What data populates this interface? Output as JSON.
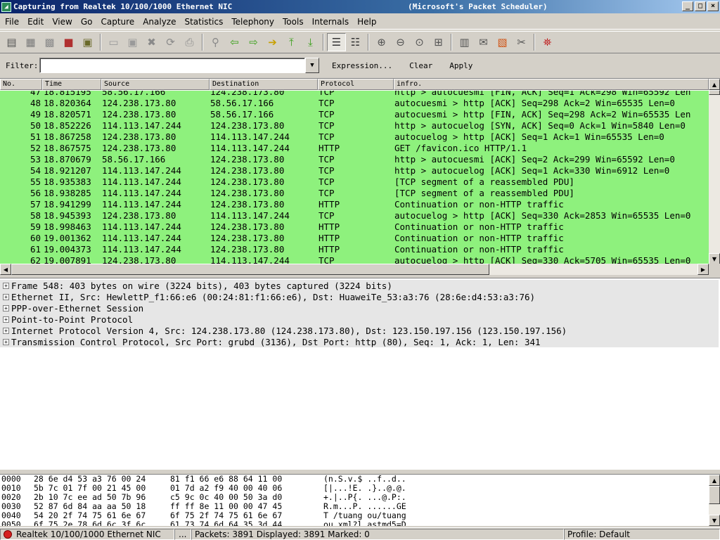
{
  "window": {
    "title": "Capturing from Realtek 10/100/1000 Ethernet NIC",
    "title_suffix": "(Microsoft's Packet Scheduler)",
    "buttons": {
      "minimize": "_",
      "maximize": "□",
      "close": "×"
    }
  },
  "menu": [
    "File",
    "Edit",
    "View",
    "Go",
    "Capture",
    "Analyze",
    "Statistics",
    "Telephony",
    "Tools",
    "Internals",
    "Help"
  ],
  "toolbar": {
    "icons": [
      {
        "name": "interfaces-icon",
        "glyph": "▤",
        "color": "#555555"
      },
      {
        "name": "capture-options-icon",
        "glyph": "▦",
        "color": "#7a7a7a"
      },
      {
        "name": "start-capture-icon",
        "glyph": "▩",
        "color": "#8a8a8a"
      },
      {
        "name": "stop-capture-icon",
        "glyph": "■",
        "color": "#b03030"
      },
      {
        "name": "restart-capture-icon",
        "glyph": "▣",
        "color": "#6a6a2a"
      },
      {
        "name": "sep"
      },
      {
        "name": "open-file-icon",
        "glyph": "▭",
        "color": "#9a9a9a"
      },
      {
        "name": "save-file-icon",
        "glyph": "▣",
        "color": "#9a9a9a"
      },
      {
        "name": "close-file-icon",
        "glyph": "✖",
        "color": "#8a8a8a"
      },
      {
        "name": "reload-icon",
        "glyph": "⟳",
        "color": "#8a8a8a"
      },
      {
        "name": "print-icon",
        "glyph": "⎙",
        "color": "#8a8a8a"
      },
      {
        "name": "sep"
      },
      {
        "name": "find-packet-icon",
        "glyph": "⚲",
        "color": "#8a8a8a"
      },
      {
        "name": "go-back-icon",
        "glyph": "⇦",
        "color": "#3aa01a"
      },
      {
        "name": "go-forward-icon",
        "glyph": "⇨",
        "color": "#3aa01a"
      },
      {
        "name": "go-to-packet-icon",
        "glyph": "➔",
        "color": "#c8a000"
      },
      {
        "name": "go-first-icon",
        "glyph": "⤒",
        "color": "#3aa01a"
      },
      {
        "name": "go-last-icon",
        "glyph": "⤓",
        "color": "#3aa01a"
      },
      {
        "name": "sep"
      },
      {
        "name": "colorize-icon",
        "glyph": "☰",
        "color": "#333333",
        "active": true
      },
      {
        "name": "auto-scroll-icon",
        "glyph": "☷",
        "color": "#333333"
      },
      {
        "name": "sep"
      },
      {
        "name": "zoom-in-icon",
        "glyph": "⊕",
        "color": "#555555"
      },
      {
        "name": "zoom-out-icon",
        "glyph": "⊖",
        "color": "#555555"
      },
      {
        "name": "zoom-normal-icon",
        "glyph": "⊙",
        "color": "#555555"
      },
      {
        "name": "resize-columns-icon",
        "glyph": "⊞",
        "color": "#555555"
      },
      {
        "name": "sep"
      },
      {
        "name": "capture-filters-icon",
        "glyph": "▥",
        "color": "#555555"
      },
      {
        "name": "display-filters-icon",
        "glyph": "✉",
        "color": "#555555"
      },
      {
        "name": "coloring-rules-icon",
        "glyph": "▧",
        "color": "#d05010"
      },
      {
        "name": "preferences-icon",
        "glyph": "✂",
        "color": "#555555"
      },
      {
        "name": "sep"
      },
      {
        "name": "help-icon",
        "glyph": "⛯",
        "color": "#c02020"
      }
    ]
  },
  "filter": {
    "label": "Filter:",
    "value": "",
    "dropdown_glyph": "▼",
    "expression": "Expression...",
    "clear": "Clear",
    "apply": "Apply"
  },
  "packet_list": {
    "columns": [
      "No.",
      "Time",
      "Source",
      "Destination",
      "Protocol",
      "infro."
    ],
    "row_color": "#8ef17d",
    "rows": [
      [
        "47",
        "18.815195",
        "58.56.17.166",
        "124.238.173.80",
        "TCP",
        "http > autocuesmi [FIN, ACK] Seq=1 Ack=298 Win=65592 Len"
      ],
      [
        "48",
        "18.820364",
        "124.238.173.80",
        "58.56.17.166",
        "TCP",
        "autocuesmi > http [ACK] Seq=298 Ack=2 Win=65535 Len=0"
      ],
      [
        "49",
        "18.820571",
        "124.238.173.80",
        "58.56.17.166",
        "TCP",
        "autocuesmi > http [FIN, ACK] Seq=298 Ack=2 Win=65535 Len"
      ],
      [
        "50",
        "18.852226",
        "114.113.147.244",
        "124.238.173.80",
        "TCP",
        "http > autocuelog [SYN, ACK] Seq=0 Ack=1 Win=5840 Len=0"
      ],
      [
        "51",
        "18.867258",
        "124.238.173.80",
        "114.113.147.244",
        "TCP",
        "autocuelog > http [ACK] Seq=1 Ack=1 Win=65535 Len=0"
      ],
      [
        "52",
        "18.867575",
        "124.238.173.80",
        "114.113.147.244",
        "HTTP",
        "GET /favicon.ico HTTP/1.1"
      ],
      [
        "53",
        "18.870679",
        "58.56.17.166",
        "124.238.173.80",
        "TCP",
        "http > autocuesmi [ACK] Seq=2 Ack=299 Win=65592 Len=0"
      ],
      [
        "54",
        "18.921207",
        "114.113.147.244",
        "124.238.173.80",
        "TCP",
        "http > autocuelog [ACK] Seq=1 Ack=330 Win=6912 Len=0"
      ],
      [
        "55",
        "18.935383",
        "114.113.147.244",
        "124.238.173.80",
        "TCP",
        "[TCP segment of a reassembled PDU]"
      ],
      [
        "56",
        "18.938285",
        "114.113.147.244",
        "124.238.173.80",
        "TCP",
        "[TCP segment of a reassembled PDU]"
      ],
      [
        "57",
        "18.941299",
        "114.113.147.244",
        "124.238.173.80",
        "HTTP",
        "Continuation or non-HTTP traffic"
      ],
      [
        "58",
        "18.945393",
        "124.238.173.80",
        "114.113.147.244",
        "TCP",
        "autocuelog > http [ACK] Seq=330 Ack=2853 Win=65535 Len=0"
      ],
      [
        "59",
        "18.998463",
        "114.113.147.244",
        "124.238.173.80",
        "HTTP",
        "Continuation or non-HTTP traffic"
      ],
      [
        "60",
        "19.001362",
        "114.113.147.244",
        "124.238.173.80",
        "HTTP",
        "Continuation or non-HTTP traffic"
      ],
      [
        "61",
        "19.004373",
        "114.113.147.244",
        "124.238.173.80",
        "HTTP",
        "Continuation or non-HTTP traffic"
      ],
      [
        "62",
        "19.007891",
        "124.238.173.80",
        "114.113.147.244",
        "TCP",
        "autocuelog > http [ACK] Seq=330 Ack=5705 Win=65535 Len=0"
      ]
    ]
  },
  "details": [
    "Frame 548: 403 bytes on wire (3224 bits), 403 bytes captured (3224 bits)",
    "Ethernet II, Src: HewlettP_f1:66:e6 (00:24:81:f1:66:e6), Dst: HuaweiTe_53:a3:76 (28:6e:d4:53:a3:76)",
    "PPP-over-Ethernet Session",
    "Point-to-Point Protocol",
    "Internet Protocol Version 4, Src: 124.238.173.80 (124.238.173.80), Dst: 123.150.197.156 (123.150.197.156)",
    "Transmission Control Protocol, Src Port: grubd (3136), Dst Port: http (80), Seq: 1, Ack: 1, Len: 341"
  ],
  "details_expander": "+",
  "hex": [
    [
      "0000",
      "28 6e d4 53 a3 76 00 24",
      "81 f1 66 e6 88 64 11 00",
      "(n.S.v.$ ..f..d.."
    ],
    [
      "0010",
      "5b 7c 01 7f 00 21 45 00",
      "01 7d a2 f9 40 00 40 06",
      "[|...!E. .}..@.@."
    ],
    [
      "0020",
      "2b 10 7c ee ad 50 7b 96",
      "c5 9c 0c 40 00 50 3a d0",
      "+.|..P{. ...@.P:."
    ],
    [
      "0030",
      "52 87 6d 84 aa aa 50 18",
      "ff ff 8e 11 00 00 47 45",
      "R.m...P. ......GE"
    ],
    [
      "0040",
      "54 20 2f 74 75 61 6e 67",
      "6f 75 2f 74 75 61 6e 67",
      "T /tuang ou/tuang"
    ],
    [
      "0050",
      "6f 75 2e 78 6d 6c 3f 6c",
      "61 73 74 6d 64 35 3d 44",
      "ou.xml?l astmd5=D"
    ]
  ],
  "scroll_glyphs": {
    "up": "▲",
    "down": "▼",
    "left": "◀",
    "right": "▶"
  },
  "status": {
    "interface": "Realtek 10/100/1000 Ethernet NIC",
    "more": "...",
    "packets": "Packets: 3891 Displayed: 3891 Marked: 0",
    "profile": "Profile: Default"
  }
}
